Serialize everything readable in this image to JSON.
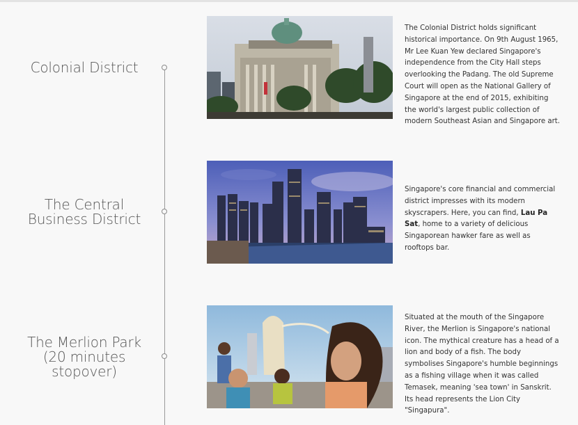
{
  "sections": [
    {
      "title_lines": [
        "Colonial District"
      ],
      "image_alt": "Old Supreme Court building with green dome and palm trees",
      "description": "The Colonial District holds significant historical importance. On 9th August 1965, Mr Lee Kuan Yew declared Singapore's independence from the City Hall steps overlooking the Padang. The old Supreme Court will open as the National Gallery of Singapore at the end of 2015, exhibiting the world's largest public collection of modern Southeast Asian and Singapore art."
    },
    {
      "title_lines": [
        "The Central",
        "Business District"
      ],
      "image_alt": "Singapore CBD skyscrapers at dusk over the river",
      "description_before": "Singapore's core financial and commercial district impresses with its modern skyscrapers. Here, you can find, ",
      "description_bold": "Lau Pa Sat",
      "description_after": ", home to a variety of delicious Singaporean hawker fare as well as rooftops bar."
    },
    {
      "title_lines": [
        "The Merlion Park",
        "(20 minutes",
        "stopover)"
      ],
      "image_alt": "Family posing in front of the Merlion statue",
      "description": "Situated at the mouth of the Singapore River, the Merlion is Singapore's national icon. The mythical creature has a head of a lion and body of a fish. The body symbolises Singapore's humble beginnings as a fishing village when it was called Temasek, meaning 'sea town' in Sanskrit. Its head represents the Lion City \"Singapura\"."
    }
  ]
}
